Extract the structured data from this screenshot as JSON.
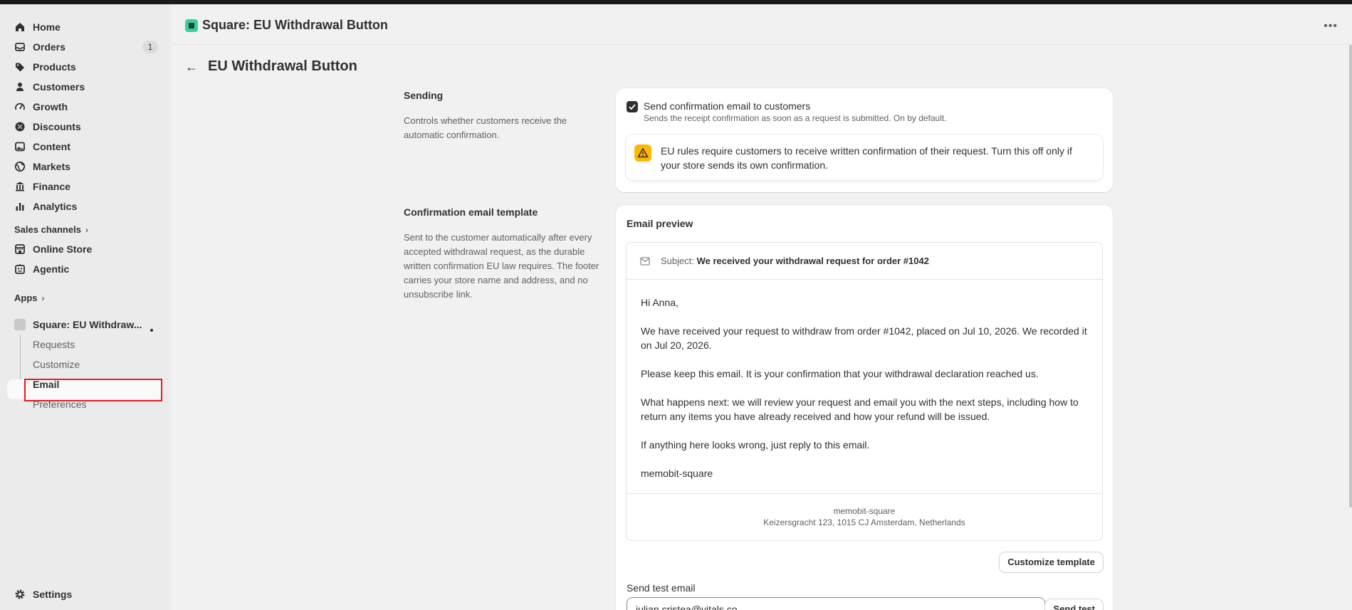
{
  "sidebar": {
    "items": [
      {
        "label": "Home",
        "icon": "home-icon"
      },
      {
        "label": "Orders",
        "icon": "inbox-icon",
        "badge": "1"
      },
      {
        "label": "Products",
        "icon": "tag-icon"
      },
      {
        "label": "Customers",
        "icon": "person-icon"
      },
      {
        "label": "Growth",
        "icon": "gauge-icon"
      },
      {
        "label": "Discounts",
        "icon": "discount-icon"
      },
      {
        "label": "Content",
        "icon": "image-icon"
      },
      {
        "label": "Markets",
        "icon": "globe-icon"
      },
      {
        "label": "Finance",
        "icon": "bank-icon"
      },
      {
        "label": "Analytics",
        "icon": "bar-chart-icon"
      }
    ],
    "sales_channels_label": "Sales channels",
    "channels": [
      {
        "label": "Online Store",
        "icon": "store-icon"
      },
      {
        "label": "Agentic",
        "icon": "robot-icon"
      }
    ],
    "apps_label": "Apps",
    "app": {
      "label": "Square: EU Withdraw...",
      "subitems": [
        "Requests",
        "Customize",
        "Email",
        "Preferences"
      ]
    },
    "settings_label": "Settings"
  },
  "header": {
    "app_title": "Square: EU Withdrawal Button"
  },
  "page": {
    "title": "EU Withdrawal Button"
  },
  "sending": {
    "title": "Sending",
    "description": "Controls whether customers receive the automatic confirmation.",
    "checkbox_label": "Send confirmation email to customers",
    "checkbox_checked": true,
    "checkbox_help": "Sends the receipt confirmation as soon as a request is submitted. On by default.",
    "banner_text": "EU rules require customers to receive written confirmation of their request. Turn this off only if your store sends its own confirmation."
  },
  "template": {
    "title": "Confirmation email template",
    "description": "Sent to the customer automatically after every accepted withdrawal request, as the durable written confirmation EU law requires. The footer carries your store name and address, and no unsubscribe link.",
    "preview_heading": "Email preview",
    "subject_label": "Subject:",
    "subject": "We received your withdrawal request for order #1042",
    "body": [
      "Hi Anna,",
      "We have received your request to withdraw from order #1042, placed on Jul 10, 2026. We recorded it on Jul 20, 2026.",
      "Please keep this email. It is your confirmation that your withdrawal declaration reached us.",
      "What happens next: we will review your request and email you with the next steps, including how to return any items you have already received and how your refund will be issued.",
      "If anything here looks wrong, just reply to this email.",
      "memobit-square"
    ],
    "footer_store": "memobit-square",
    "footer_address": "Keizersgracht 123, 1015 CJ Amsterdam, Netherlands",
    "customize_button": "Customize template",
    "send_test_label": "Send test email",
    "send_test_value": "julian.cristea@vitals.co",
    "send_test_button": "Send test"
  },
  "colors": {
    "accent_app": "#35d39a",
    "warning": "#ffb800",
    "highlight": "#e51c23"
  }
}
